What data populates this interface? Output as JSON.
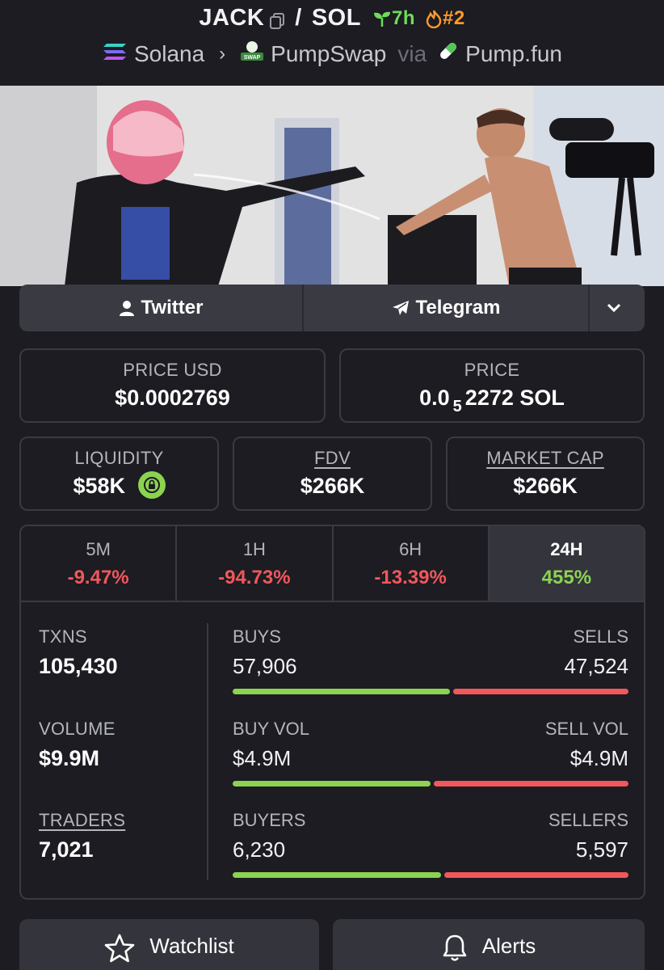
{
  "header": {
    "base_symbol": "JACK",
    "quote_symbol": "SOL",
    "separator": "/",
    "age": "7h",
    "rank": "#2",
    "chain": "Solana",
    "dex": "PumpSwap",
    "via_label": "via",
    "launchpad": "Pump.fun",
    "colors": {
      "age": "#6fdc5a",
      "rank": "#ff9c2a"
    }
  },
  "banner": {
    "icon": "token-banner-photo"
  },
  "socials": {
    "twitter_label": "Twitter",
    "telegram_label": "Telegram"
  },
  "prices": {
    "price_usd_label": "PRICE USD",
    "price_usd": "$0.0002769",
    "price_label": "PRICE",
    "price_native_prefix": "0.0",
    "price_native_zeros": "5",
    "price_native_digits": "2272 SOL"
  },
  "stats": {
    "liquidity_label": "LIQUIDITY",
    "liquidity": "$58K",
    "fdv_label": "FDV",
    "fdv": "$266K",
    "mcap_label": "MARKET CAP",
    "mcap": "$266K"
  },
  "timeframes": [
    {
      "label": "5M",
      "change": "-9.47%",
      "direction": "down"
    },
    {
      "label": "1H",
      "change": "-94.73%",
      "direction": "down"
    },
    {
      "label": "6H",
      "change": "-13.39%",
      "direction": "down"
    },
    {
      "label": "24H",
      "change": "455%",
      "direction": "up",
      "active": true
    }
  ],
  "activity": {
    "txns_label": "TXNS",
    "txns": "105,430",
    "volume_label": "VOLUME",
    "volume": "$9.9M",
    "traders_label": "TRADERS",
    "traders": "7,021",
    "buys_label": "BUYS",
    "buys": "57,906",
    "sells_label": "SELLS",
    "sells": "47,524",
    "buy_vol_label": "BUY VOL",
    "buy_vol": "$4.9M",
    "sell_vol_label": "SELL VOL",
    "sell_vol": "$4.9M",
    "buyers_label": "BUYERS",
    "buyers": "6,230",
    "sellers_label": "SELLERS",
    "sellers": "5,597",
    "buy_share_txns": 0.549,
    "buy_share_vol": 0.5,
    "buy_share_traders": 0.527
  },
  "actions": {
    "watchlist_label": "Watchlist",
    "alerts_label": "Alerts"
  }
}
